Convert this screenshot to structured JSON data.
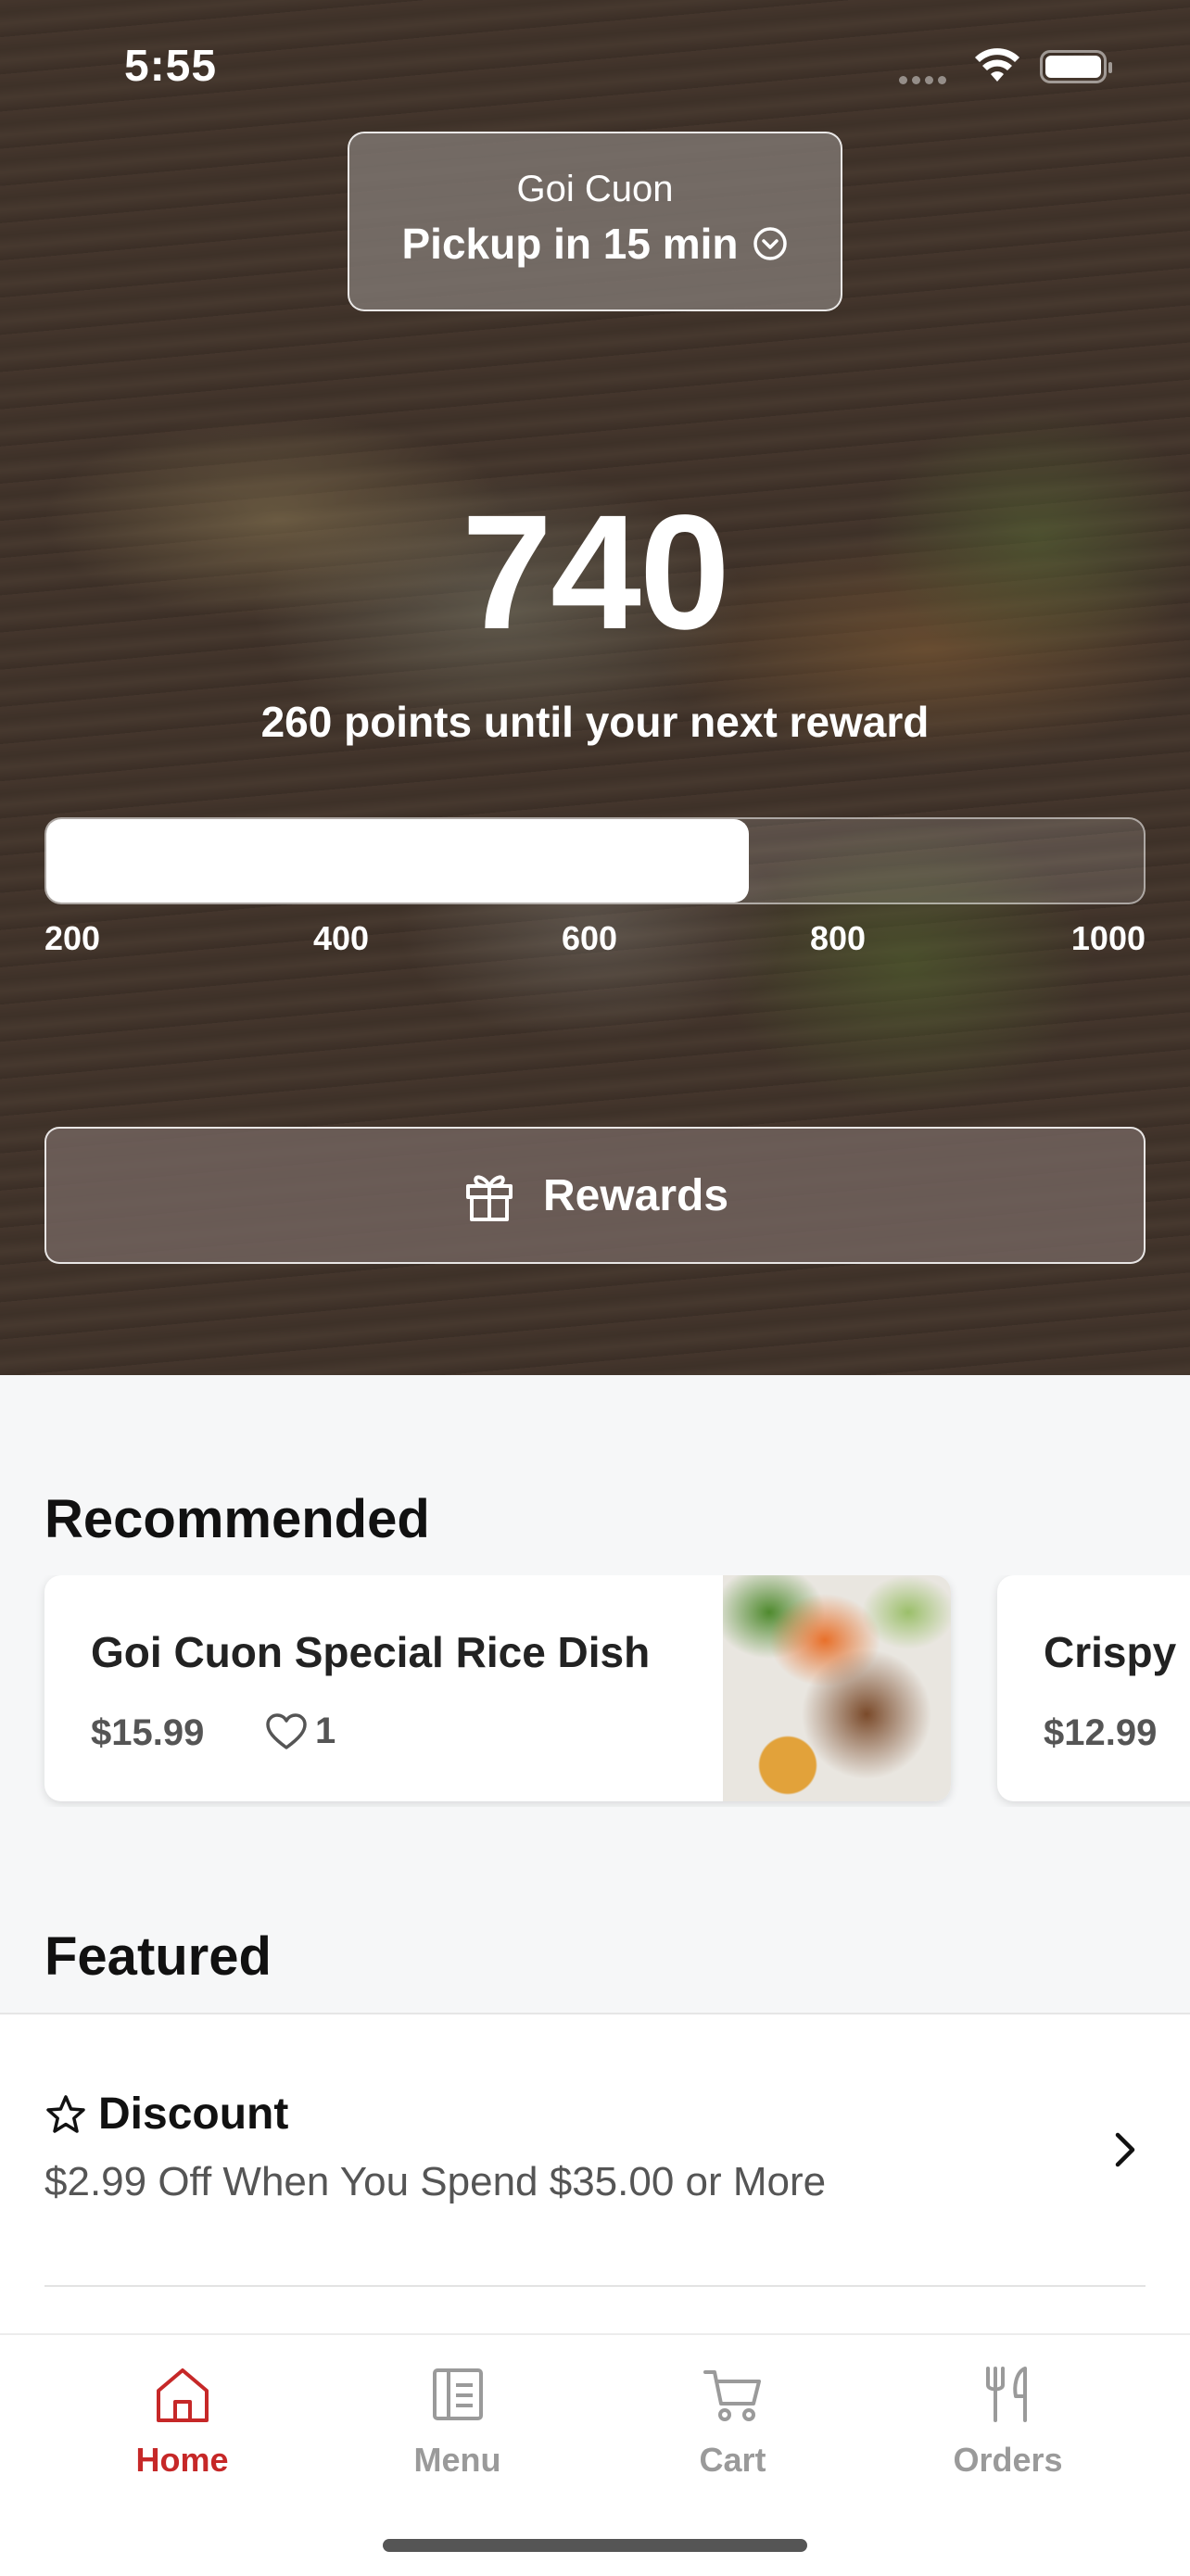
{
  "status_bar": {
    "time": "5:55"
  },
  "location": {
    "name": "Goi Cuon",
    "pickup": "Pickup in 15 min"
  },
  "rewards": {
    "points": "740",
    "subtitle": "260 points until your next reward",
    "progress_fraction": 0.64,
    "ticks": [
      "200",
      "400",
      "600",
      "800",
      "1000"
    ],
    "button_label": "Rewards"
  },
  "recommended": {
    "title": "Recommended",
    "items": [
      {
        "name": "Goi Cuon Special Rice Dish",
        "price": "$15.99",
        "likes": "1"
      },
      {
        "name": "Crispy",
        "price": "$12.99"
      }
    ]
  },
  "featured": {
    "title": "Featured",
    "items": [
      {
        "title": "Discount",
        "description": "$2.99 Off When You Spend $35.00 or More"
      }
    ]
  },
  "tabs": [
    {
      "label": "Home",
      "icon": "home-icon",
      "active": true
    },
    {
      "label": "Menu",
      "icon": "menu-icon"
    },
    {
      "label": "Cart",
      "icon": "cart-icon"
    },
    {
      "label": "Orders",
      "icon": "orders-icon"
    }
  ],
  "colors": {
    "accent": "#c62828",
    "tab_inactive": "#9a9a9a"
  }
}
